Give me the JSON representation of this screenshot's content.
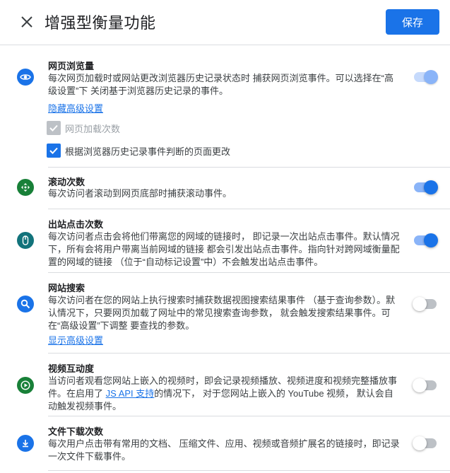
{
  "header": {
    "title": "增强型衡量功能",
    "save_label": "保存"
  },
  "sections": [
    {
      "id": "page-views",
      "icon": "eye-icon",
      "icon_color": "#1a73e8",
      "title": "网页浏览量",
      "description": "每次网页加载时或网站更改浏览器历史记录状态时 捕获网页浏览事件。可以选择在“高级设置”下 关闭基于浏览器历史记录的事件。",
      "link": "隐藏高级设置",
      "toggle": "on-disabled",
      "options": [
        {
          "label": "网页加载次数",
          "checked": true,
          "disabled": true
        },
        {
          "label": "根据浏览器历史记录事件判断的页面更改",
          "checked": true,
          "disabled": false
        }
      ]
    },
    {
      "id": "scrolls",
      "icon": "scroll-icon",
      "icon_color": "#188038",
      "title": "滚动次数",
      "description": "每次访问者滚动到网页底部时捕获滚动事件。",
      "toggle": "on"
    },
    {
      "id": "outbound-clicks",
      "icon": "mouse-icon",
      "icon_color": "#12737b",
      "title": "出站点击次数",
      "description": "每次访问者点击会将他们带离您的网域的链接时， 即记录一次出站点击事件。默认情况下，所有会将用户带离当前网域的链接 都会引发出站点击事件。指向针对跨网域衡量配置的网域的链接 （位于“自动标记设置”中）不会触发出站点击事件。",
      "toggle": "on"
    },
    {
      "id": "site-search",
      "icon": "search-icon",
      "icon_color": "#1a73e8",
      "title": "网站搜索",
      "description": "每次访问者在您的网站上执行搜索时捕获数据视图搜索结果事件 （基于查询参数）。默认情况下，只要网页加载了网址中的常见搜索查询参数， 就会触发搜索结果事件。可在“高级设置”下调整 要查找的参数。",
      "link": "显示高级设置",
      "toggle": "off"
    },
    {
      "id": "video-engagement",
      "icon": "play-icon",
      "icon_color": "#188038",
      "title": "视频互动度",
      "description_before": "当访问者观看您网站上嵌入的视频时，即会记录视频播放、视频进度和视频完整播放事件。在启用了 ",
      "description_link": "JS API 支持",
      "description_after": "的情况下， 对于您网站上嵌入的 YouTube 视频， 默认会自动触发视频事件。",
      "toggle": "off"
    },
    {
      "id": "file-downloads",
      "icon": "download-icon",
      "icon_color": "#1a73e8",
      "title": "文件下载次数",
      "description": "每次用户点击带有常用的文档、 压缩文件、应用、视频或音频扩展名的链接时，即记录一次文件下载事件。",
      "toggle": "off"
    }
  ]
}
